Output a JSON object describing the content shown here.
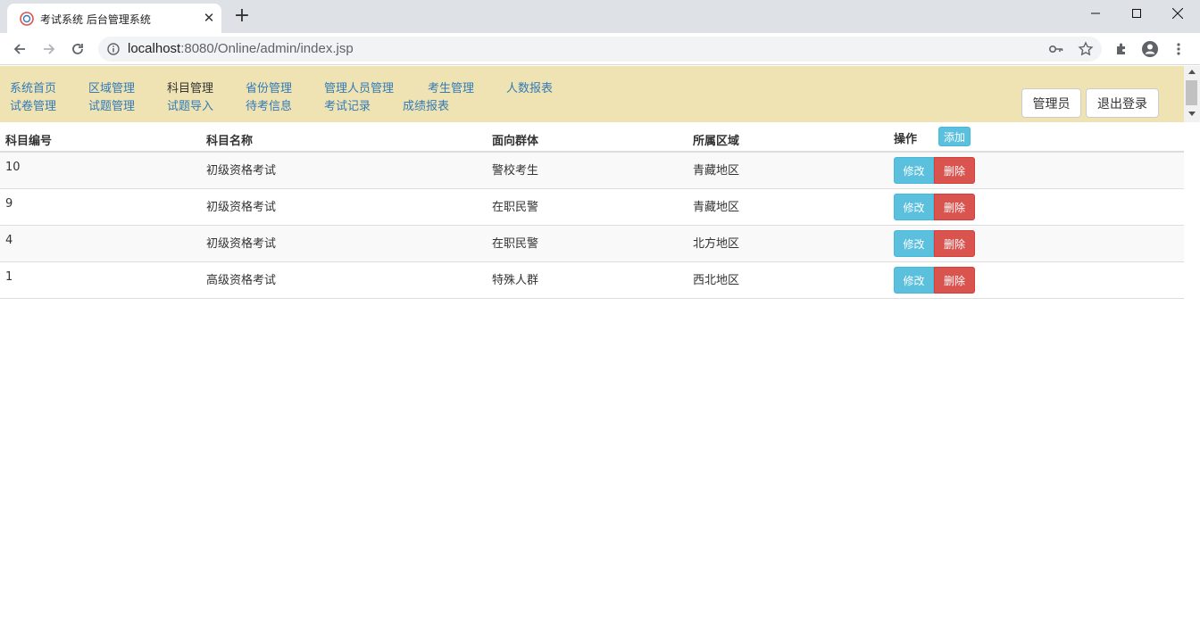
{
  "browser": {
    "tab_title": "考试系统 后台管理系统",
    "url_host": "localhost",
    "url_path": ":8080/Online/admin/index.jsp"
  },
  "nav": {
    "row1": [
      "系统首页",
      "区域管理",
      "科目管理",
      "省份管理",
      "管理人员管理",
      "考生管理",
      "人数报表"
    ],
    "row2": [
      "试卷管理",
      "试题管理",
      "试题导入",
      "待考信息",
      "考试记录",
      "成绩报表"
    ],
    "active": "科目管理",
    "admin_label": "管理员",
    "logout_label": "退出登录"
  },
  "table": {
    "headers": [
      "科目编号",
      "科目名称",
      "面向群体",
      "所属区域",
      "操作"
    ],
    "add_label": "添加",
    "edit_label": "修改",
    "delete_label": "删除",
    "rows": [
      [
        "10",
        "初级资格考试",
        "警校考生",
        "青藏地区"
      ],
      [
        "9",
        "初级资格考试",
        "在职民警",
        "青藏地区"
      ],
      [
        "4",
        "初级资格考试",
        "在职民警",
        "北方地区"
      ],
      [
        "1",
        "高级资格考试",
        "特殊人群",
        "西北地区"
      ]
    ]
  },
  "colors": {
    "navbar_bg": "#efe3b3",
    "link": "#337ab7",
    "info": "#5bc0de",
    "danger": "#d9534f"
  }
}
